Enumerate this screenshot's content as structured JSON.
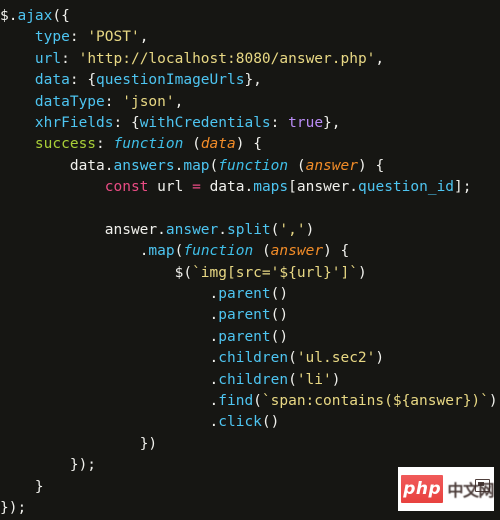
{
  "editor": {
    "language": "javascript",
    "background_color": "#161613",
    "default_text_color": "#f0f0ec",
    "font_size_px": 14.5,
    "line_height_px": 21.4,
    "colors": {
      "property": "#4ec5f1",
      "string": "#e8d884",
      "keyword_boolean": "#b98cf5",
      "keyword_const": "#ea4c84",
      "operator": "#ea4c84",
      "success_key": "#a9cf38",
      "function_keyword": "#3fbfe8",
      "parameter": "#f28c28",
      "punctuation": "#f0f0ec"
    },
    "lines": [
      {
        "id": 1,
        "indent": 0,
        "text": "$.ajax({"
      },
      {
        "id": 2,
        "indent": 1,
        "text": "type: 'POST',"
      },
      {
        "id": 3,
        "indent": 1,
        "text": "url: 'http://localhost:8080/answer.php',"
      },
      {
        "id": 4,
        "indent": 1,
        "text": "data: {questionImageUrls},"
      },
      {
        "id": 5,
        "indent": 1,
        "text": "dataType: 'json',"
      },
      {
        "id": 6,
        "indent": 1,
        "text": "xhrFields: {withCredentials: true},"
      },
      {
        "id": 7,
        "indent": 1,
        "text": "success: function (data) {"
      },
      {
        "id": 8,
        "indent": 2,
        "text": "data.answers.map(function (answer) {"
      },
      {
        "id": 9,
        "indent": 3,
        "text": "const url = data.maps[answer.question_id];"
      },
      {
        "id": 10,
        "indent": 0,
        "text": ""
      },
      {
        "id": 11,
        "indent": 3,
        "text": "answer.answer.split(',')"
      },
      {
        "id": 12,
        "indent": 4,
        "text": ".map(function (answer) {"
      },
      {
        "id": 13,
        "indent": 5,
        "text": "$(`img[src='${url}']`)"
      },
      {
        "id": 14,
        "indent": 6,
        "text": ".parent()"
      },
      {
        "id": 15,
        "indent": 6,
        "text": ".parent()"
      },
      {
        "id": 16,
        "indent": 6,
        "text": ".parent()"
      },
      {
        "id": 17,
        "indent": 6,
        "text": ".children('ul.sec2')"
      },
      {
        "id": 18,
        "indent": 6,
        "text": ".children('li')"
      },
      {
        "id": 19,
        "indent": 6,
        "text": ".find(`span:contains(${answer})`)"
      },
      {
        "id": 20,
        "indent": 6,
        "text": ".click()"
      },
      {
        "id": 21,
        "indent": 4,
        "text": "})"
      },
      {
        "id": 22,
        "indent": 2,
        "text": "});"
      },
      {
        "id": 23,
        "indent": 1,
        "text": "}"
      },
      {
        "id": 24,
        "indent": 0,
        "text": "});"
      }
    ]
  },
  "watermark": {
    "logo_text": "php",
    "brand_text": "中文网",
    "badge_icon": "monitor-icon",
    "logo_background": "#e8423f",
    "panel_background": "#ffffff"
  }
}
